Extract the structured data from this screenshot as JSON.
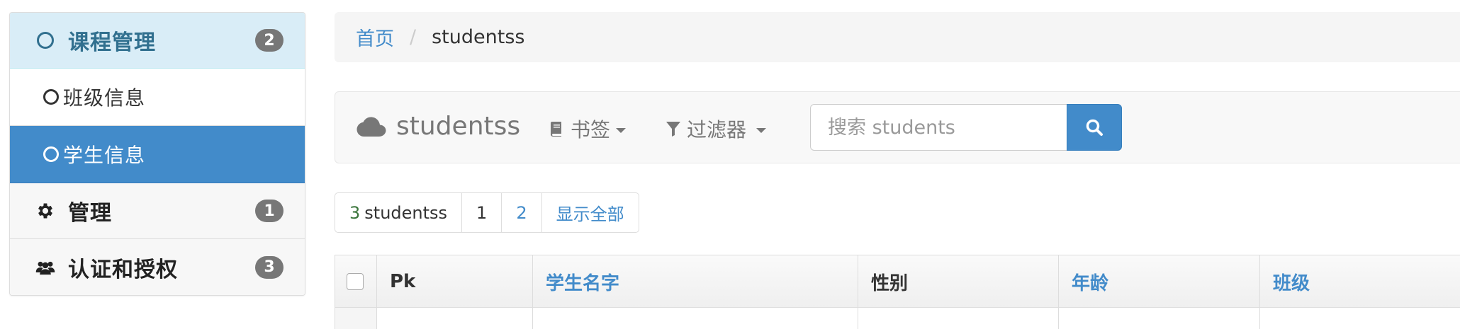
{
  "sidebar": {
    "groups": [
      {
        "label": "课程管理",
        "badge": "2",
        "icon": "circle-icon"
      },
      {
        "label": "管理",
        "badge": "1",
        "icon": "gear-icon"
      },
      {
        "label": "认证和授权",
        "badge": "3",
        "icon": "users-icon"
      }
    ],
    "sub_items": [
      {
        "label": "班级信息",
        "icon": "circle-icon"
      },
      {
        "label": "学生信息",
        "icon": "circle-icon"
      }
    ]
  },
  "breadcrumb": {
    "home": "首页",
    "separator": "/",
    "current": "studentss"
  },
  "toolbar": {
    "brand": "studentss",
    "bookmarks_label": "书签",
    "filter_label": "过滤器",
    "search_placeholder": "搜索 students"
  },
  "pagination": {
    "count_number": "3",
    "count_label": "studentss",
    "pages": [
      "1",
      "2"
    ],
    "show_all": "显示全部"
  },
  "table": {
    "columns": [
      "Pk",
      "学生名字",
      "性别",
      "年龄",
      "班级"
    ]
  },
  "colors": {
    "primary": "#428bca",
    "group_active_bg": "#d9edf7",
    "group_active_text": "#31708f",
    "badge": "#777777",
    "success": "#3c763d"
  }
}
